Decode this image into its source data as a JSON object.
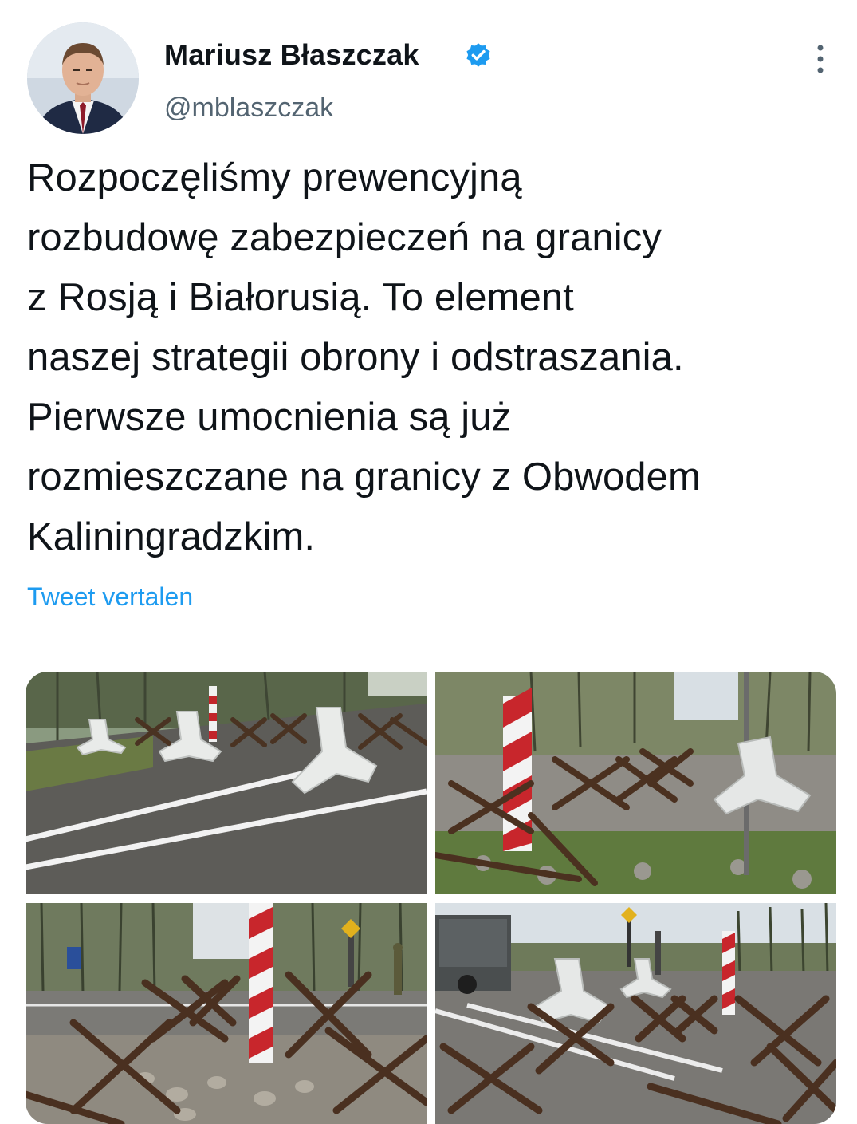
{
  "tweet": {
    "author": {
      "name": "Mariusz Błaszczak",
      "handle": "@mblaszczak",
      "verified": true,
      "avatar_icon": "profile-photo"
    },
    "more_icon": "more-vertical-icon",
    "text_lines": [
      "Rozpoczęliśmy prewencyjną",
      "rozbudowę zabezpieczeń na granicy",
      "z Rosją i Białorusią. To element",
      "naszej strategii obrony i odstraszania.",
      "Pierwsze umocnienia są już",
      "rozmieszczane na granicy z Obwodem",
      "Kaliningradzkim."
    ],
    "translate_label": "Tweet vertalen",
    "media": [
      {
        "name": "photo-1"
      },
      {
        "name": "photo-2"
      },
      {
        "name": "photo-3"
      },
      {
        "name": "photo-4"
      }
    ]
  },
  "colors": {
    "text": "#0f1419",
    "secondary": "#536471",
    "link": "#1d9bf0",
    "verified": "#1d9bf0"
  }
}
